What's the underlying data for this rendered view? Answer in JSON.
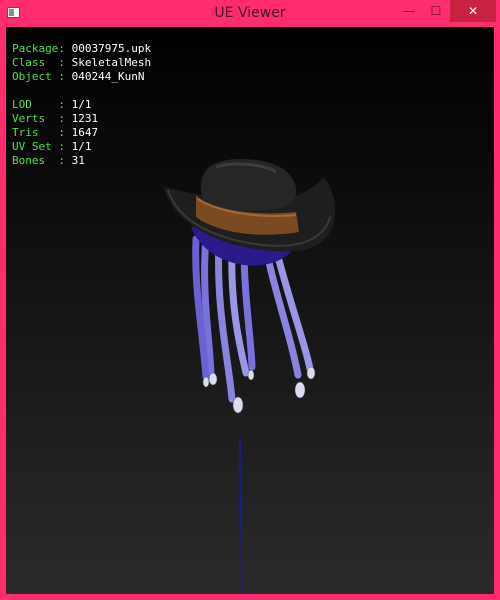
{
  "window": {
    "title": "UE Viewer",
    "min_glyph": "—",
    "max_glyph": "☐",
    "close_glyph": "✕"
  },
  "info": {
    "package_key": "Package:",
    "package_val": "00037975.upk",
    "class_key": "Class  :",
    "class_val": "SkeletalMesh",
    "object_key": "Object :",
    "object_val": "040244_KunN",
    "lod_key": "LOD    :",
    "lod_val": "1/1",
    "verts_key": "Verts  :",
    "verts_val": "1231",
    "tris_key": "Tris   :",
    "tris_val": "1647",
    "uvset_key": "UV Set :",
    "uvset_val": "1/1",
    "bones_key": "Bones  :",
    "bones_val": "31"
  },
  "colors": {
    "accent": "#ff2d6e",
    "label": "#4fe04f",
    "value": "#ffffff",
    "bone_line": "#1a1aa0"
  }
}
